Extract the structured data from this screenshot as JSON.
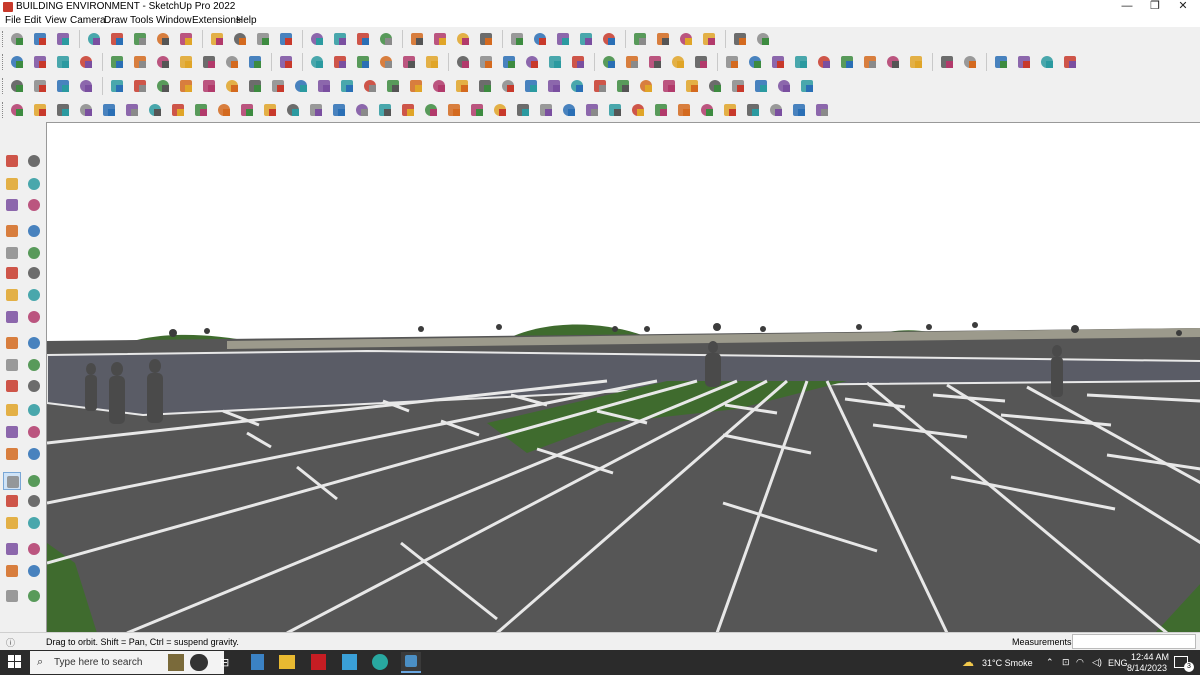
{
  "window": {
    "title": "BUILDING ENVIRONMENT - SketchUp Pro 2022",
    "minimize": "—",
    "restore": "❐",
    "close": "✕"
  },
  "menu": [
    "File",
    "Edit",
    "View",
    "Camera",
    "Draw",
    "Tools",
    "Window",
    "Extensions",
    "Help"
  ],
  "status": {
    "hint": "Drag to orbit. Shift = Pan, Ctrl = suspend gravity.",
    "measurements_label": "Measurements",
    "measurements_value": ""
  },
  "taskbar": {
    "search_placeholder": "Type here to search",
    "weather": "31°C  Smoke",
    "language": "ENG",
    "time": "12:44 AM",
    "date": "8/14/2023",
    "notification_count": "3"
  },
  "colors": {
    "ground": "#565656",
    "parking_lines": "#eeeeee",
    "plaza": "#5a5c66",
    "grass": "#3f6b2e",
    "sky": "#ffffff",
    "taskbar": "#2b2b2b",
    "accent_orbit": "#c8392b"
  },
  "icons": {
    "app": "sketchup-icon",
    "search": "search-icon",
    "start": "windows-start-icon",
    "orbit_tool_active": "orbit-icon"
  }
}
